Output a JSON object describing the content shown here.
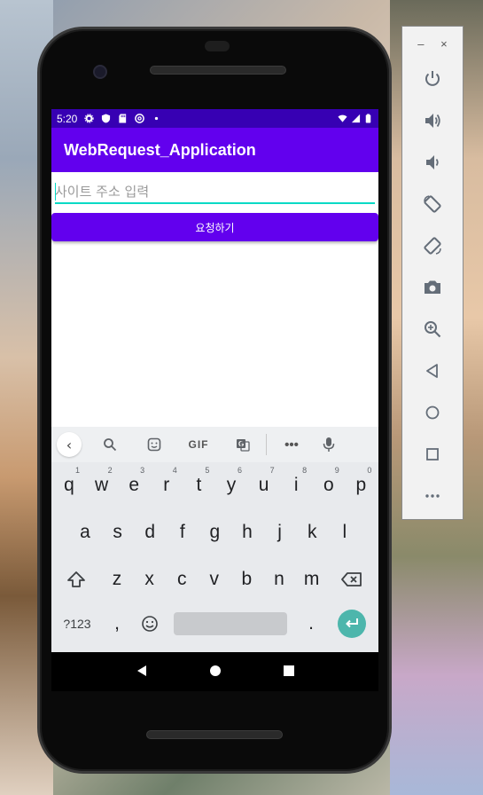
{
  "status_bar": {
    "time": "5:20",
    "left_icons": [
      "settings-icon",
      "shield-icon",
      "sd-card-icon",
      "at-sign-icon",
      "dot-icon"
    ],
    "right_icons": [
      "wifi-icon",
      "signal-icon",
      "battery-icon"
    ]
  },
  "app_bar": {
    "title": "WebRequest_Application"
  },
  "url_input": {
    "placeholder": "사이트 주소 입력",
    "value": ""
  },
  "request_button": {
    "label": "요청하기"
  },
  "keyboard": {
    "toolbar": [
      "back-icon",
      "search-icon",
      "sticker-icon",
      "GIF",
      "translate-icon",
      "more-icon",
      "mic-icon"
    ],
    "gif_label": "GIF",
    "row1": [
      {
        "k": "q",
        "h": "1"
      },
      {
        "k": "w",
        "h": "2"
      },
      {
        "k": "e",
        "h": "3"
      },
      {
        "k": "r",
        "h": "4"
      },
      {
        "k": "t",
        "h": "5"
      },
      {
        "k": "y",
        "h": "6"
      },
      {
        "k": "u",
        "h": "7"
      },
      {
        "k": "i",
        "h": "8"
      },
      {
        "k": "o",
        "h": "9"
      },
      {
        "k": "p",
        "h": "0"
      }
    ],
    "row2": [
      "a",
      "s",
      "d",
      "f",
      "g",
      "h",
      "j",
      "k",
      "l"
    ],
    "row3": [
      "z",
      "x",
      "c",
      "v",
      "b",
      "n",
      "m"
    ],
    "symbols_label": "?123",
    "comma": ",",
    "period": "."
  },
  "accent_colors": {
    "status_bar": "#3700b3",
    "primary": "#6200ee",
    "underline": "#03dac5",
    "enter_key": "#4db6ac"
  },
  "emulator_panel": {
    "window_controls": [
      "–",
      "×"
    ],
    "buttons": [
      "power-icon",
      "volume-up-icon",
      "volume-down-icon",
      "rotate-left-icon",
      "rotate-right-icon",
      "camera-icon",
      "zoom-icon",
      "back-icon",
      "home-icon",
      "overview-icon",
      "more-icon"
    ]
  }
}
